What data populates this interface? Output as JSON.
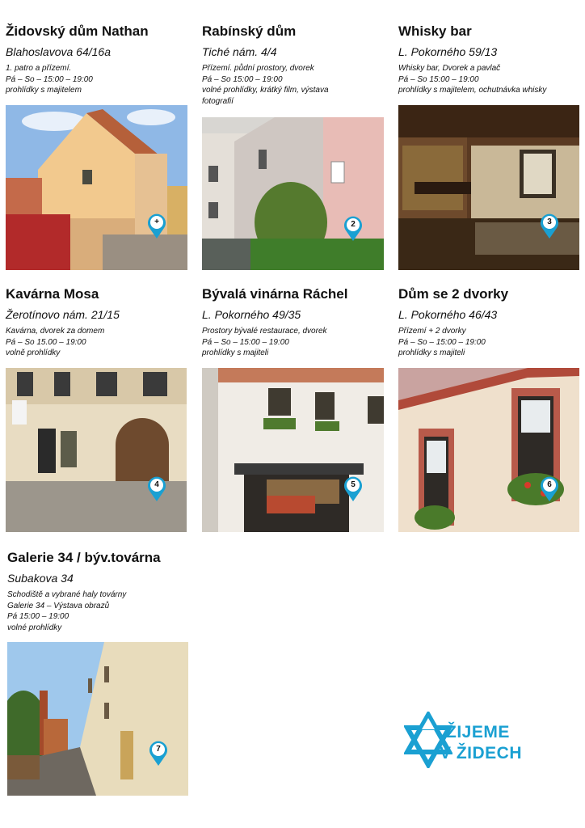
{
  "venues": [
    {
      "title": "Židovský dům Nathan",
      "address": "Blahoslavova 64/16a",
      "lines": [
        "1. patro a přízemí.",
        "Pá – So – 15:00 – 19:00",
        "prohlídky s majitelem"
      ],
      "pin": "+"
    },
    {
      "title": "Rabínský dům",
      "address": "Tiché nám. 4/4",
      "lines": [
        "Přízemí. půdní prostory, dvorek",
        "Pá – So 15:00 – 19:00",
        "volné prohlídky, krátký film, výstava",
        "fotografií"
      ],
      "pin": "2"
    },
    {
      "title": "Whisky bar",
      "address": "L. Pokorného 59/13",
      "lines": [
        "Whisky bar, Dvorek a pavlač",
        "Pá – So 15:00 – 19:00",
        "prohlídky s majitelem, ochutnávka whisky"
      ],
      "pin": "3"
    },
    {
      "title": "Kavárna Mosa",
      "address": "Žerotínovo nám. 21/15",
      "lines": [
        "Kavárna, dvorek za domem",
        "Pá – So 15.00 – 19:00",
        "volně prohlídky"
      ],
      "pin": "4"
    },
    {
      "title": "Bývalá vinárna Ráchel",
      "address": "L. Pokorného 49/35",
      "lines": [
        "Prostory bývalé restaurace, dvorek",
        "Pá – So – 15:00 – 19:00",
        "prohlídky s majiteli"
      ],
      "pin": "5"
    },
    {
      "title": "Dům se 2 dvorky",
      "address": "L. Pokorného 46/43",
      "lines": [
        "Přízemí + 2 dvorky",
        "Pá – So – 15:00 – 19:00",
        "prohlídky s majiteli"
      ],
      "pin": "6"
    },
    {
      "title": "Galerie 34 / býv.továrna",
      "address": "Subakova 34",
      "lines": [
        "Schodiště a vybrané haly továrny",
        "Galerie 34 – Výstava obrazů",
        "Pá 15:00 – 19:00",
        "volné prohlídky"
      ],
      "pin": "7"
    }
  ],
  "logo": {
    "line1": "ŽIJEME",
    "line2": "V ŽIDECH",
    "icon": "star-of-david-icon"
  },
  "colors": {
    "accent": "#1aa0d2",
    "pin_bg": "#ffffff"
  }
}
